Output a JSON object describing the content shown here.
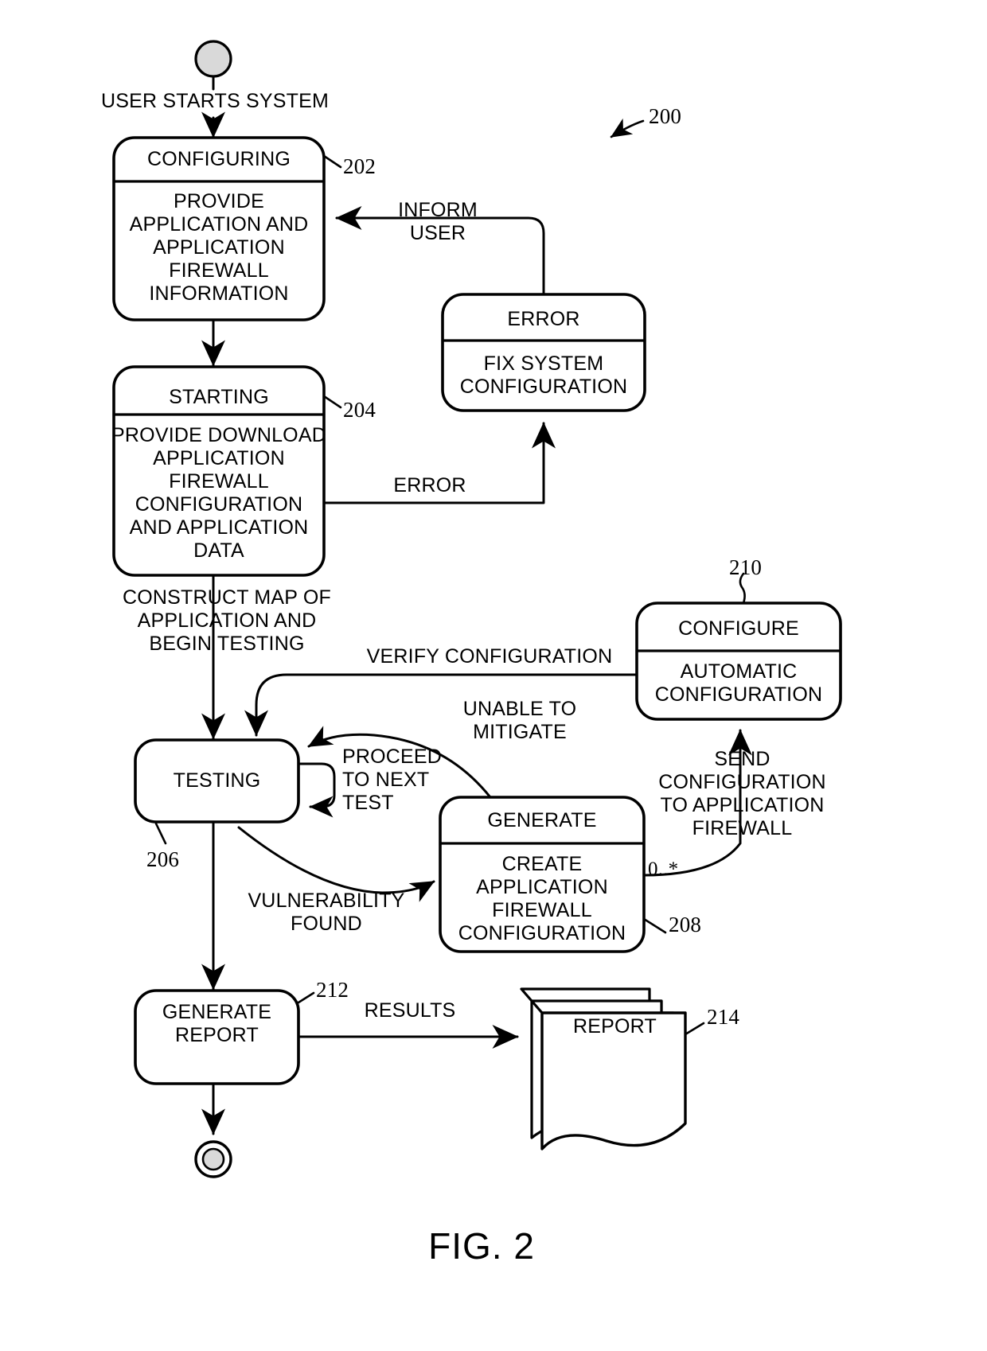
{
  "figure": {
    "label": "FIG. 2",
    "diagram_ref": "200",
    "type": "UML state machine diagram"
  },
  "states": [
    {
      "id": "configuring",
      "ref": "202",
      "title": "CONFIGURING",
      "body": "PROVIDE\nAPPLICATION AND\nAPPLICATION\nFIREWALL\nINFORMATION"
    },
    {
      "id": "starting",
      "ref": "204",
      "title": "STARTING",
      "body": "PROVIDE DOWNLOAD\nAPPLICATION\nFIREWALL\nCONFIGURATION\nAND APPLICATION\nDATA"
    },
    {
      "id": "error",
      "ref": "",
      "title": "ERROR",
      "body": "FIX SYSTEM\nCONFIGURATION"
    },
    {
      "id": "testing",
      "ref": "206",
      "title": "TESTING",
      "body": ""
    },
    {
      "id": "generate",
      "ref": "208",
      "title": "GENERATE",
      "body": "CREATE\nAPPLICATION\nFIREWALL\nCONFIGURATION"
    },
    {
      "id": "configure",
      "ref": "210",
      "title": "CONFIGURE",
      "body": "AUTOMATIC\nCONFIGURATION"
    },
    {
      "id": "generate_report",
      "ref": "212",
      "title": "GENERATE\nREPORT",
      "body": ""
    }
  ],
  "artifacts": [
    {
      "id": "report",
      "ref": "214",
      "title": "REPORT"
    }
  ],
  "transitions": [
    {
      "id": "t_start",
      "label": "USER STARTS SYSTEM"
    },
    {
      "id": "t_inform_user",
      "label": "INFORM\nUSER"
    },
    {
      "id": "t_error",
      "label": "ERROR"
    },
    {
      "id": "t_construct",
      "label": "CONSTRUCT MAP OF\nAPPLICATION AND\nBEGIN TESTING"
    },
    {
      "id": "t_verify",
      "label": "VERIFY CONFIGURATION"
    },
    {
      "id": "t_next_test",
      "label": "PROCEED\nTO NEXT\nTEST"
    },
    {
      "id": "t_unable",
      "label": "UNABLE TO\nMITIGATE"
    },
    {
      "id": "t_vuln",
      "label": "VULNERABILITY\nFOUND"
    },
    {
      "id": "t_send_config",
      "label": "SEND\nCONFIGURATION\nTO APPLICATION\nFIREWALL"
    },
    {
      "id": "t_results",
      "label": "RESULTS"
    }
  ],
  "multiplicities": [
    {
      "id": "m_generate_out",
      "label": "0..*"
    }
  ],
  "markers": {
    "initial_state": "filled-start-circle",
    "final_state": "bullseye-end-circle"
  },
  "colors": {
    "ink": "#000000",
    "paper": "#ffffff"
  }
}
